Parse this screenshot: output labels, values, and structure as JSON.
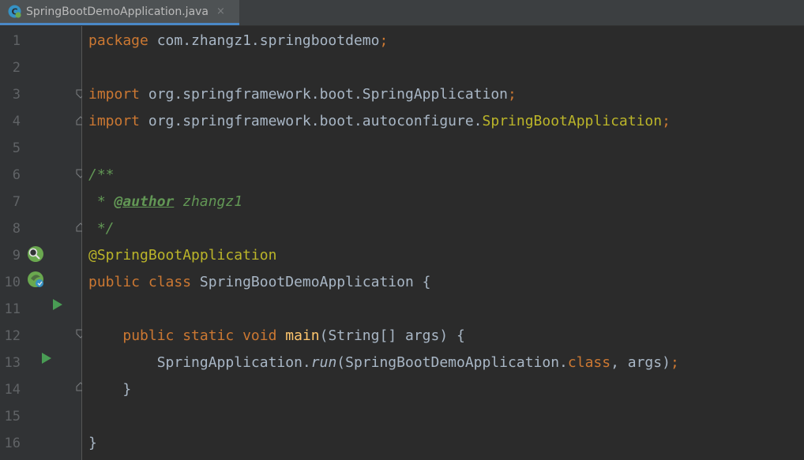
{
  "tab": {
    "filename": "SpringBootDemoApplication.java",
    "close": "×"
  },
  "colors": {
    "keyword": "#cc7832",
    "annotation": "#bbb529",
    "doc": "#629755",
    "method": "#ffc66d",
    "text": "#a9b7c6"
  },
  "lines": [
    {
      "num": "1",
      "t": [
        "package",
        " com.zhangz1.springbootdemo",
        ";"
      ]
    },
    {
      "num": "2"
    },
    {
      "num": "3",
      "t": [
        "import",
        " org.springframework.boot.SpringApplication",
        ";"
      ]
    },
    {
      "num": "4",
      "t": [
        "import",
        " org.springframework.boot.autoconfigure.",
        "SpringBootApplication",
        ";"
      ]
    },
    {
      "num": "5"
    },
    {
      "num": "6",
      "t": [
        "/**"
      ]
    },
    {
      "num": "7",
      "t": [
        " * ",
        "@author",
        " zhangz1"
      ]
    },
    {
      "num": "8",
      "t": [
        " */"
      ]
    },
    {
      "num": "9",
      "t": [
        "@SpringBootApplication"
      ]
    },
    {
      "num": "10",
      "t": [
        "public class",
        " SpringBootDemoApplication {"
      ]
    },
    {
      "num": "11"
    },
    {
      "num": "12",
      "t": [
        "    ",
        "public static void ",
        "main",
        "(String[] args) {"
      ]
    },
    {
      "num": "13",
      "t": [
        "        SpringApplication.",
        "run",
        "(SpringBootDemoApplication.",
        "class",
        ", args)",
        ";"
      ]
    },
    {
      "num": "14",
      "t": [
        "    }"
      ]
    },
    {
      "num": "15"
    },
    {
      "num": "16",
      "t": [
        "}"
      ]
    }
  ]
}
